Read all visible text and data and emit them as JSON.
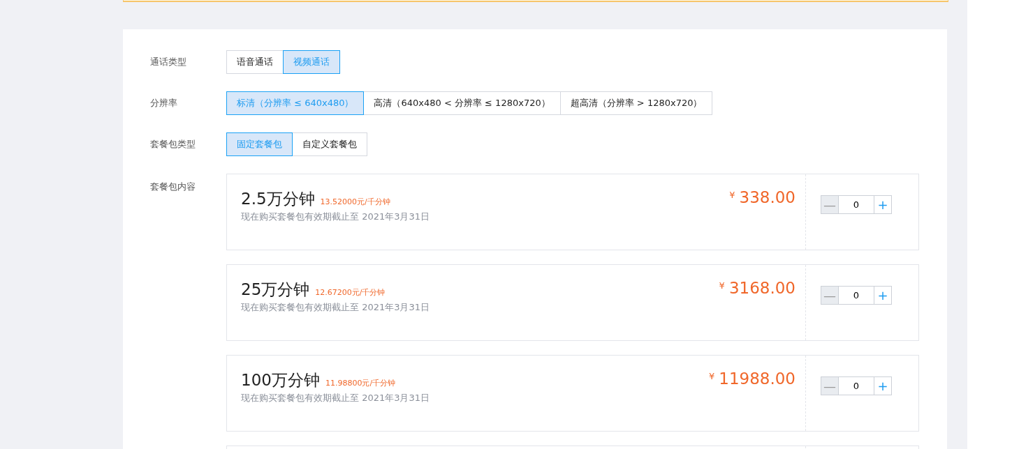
{
  "form": [
    {
      "label": "通话类型",
      "options": [
        {
          "label": "语音通话",
          "selected": false
        },
        {
          "label": "视频通话",
          "selected": true
        }
      ]
    },
    {
      "label": "分辨率",
      "options": [
        {
          "label": "标清（分辨率 ≤ 640x480）",
          "selected": true
        },
        {
          "label": "高清（640x480 < 分辨率 ≤ 1280x720）",
          "selected": false
        },
        {
          "label": "超高清（分辨率 > 1280x720）",
          "selected": false
        }
      ]
    },
    {
      "label": "套餐包类型",
      "options": [
        {
          "label": "固定套餐包",
          "selected": true
        },
        {
          "label": "自定义套餐包",
          "selected": false
        }
      ]
    }
  ],
  "packages_label": "套餐包内容",
  "packages": [
    {
      "title": "2.5万分钟",
      "unit_price": "13.52000元/千分钟",
      "validity": "现在购买套餐包有效期截止至 2021年3月31日",
      "currency": "¥",
      "price": "338.00",
      "minus": "—",
      "quantity": "0",
      "plus": "+"
    },
    {
      "title": "25万分钟",
      "unit_price": "12.67200元/千分钟",
      "validity": "现在购买套餐包有效期截止至 2021年3月31日",
      "currency": "¥",
      "price": "3168.00",
      "minus": "—",
      "quantity": "0",
      "plus": "+"
    },
    {
      "title": "100万分钟",
      "unit_price": "11.98800元/千分钟",
      "validity": "现在购买套餐包有效期截止至 2021年3月31日",
      "currency": "¥",
      "price": "11988.00",
      "minus": "—",
      "quantity": "0",
      "plus": "+"
    }
  ]
}
